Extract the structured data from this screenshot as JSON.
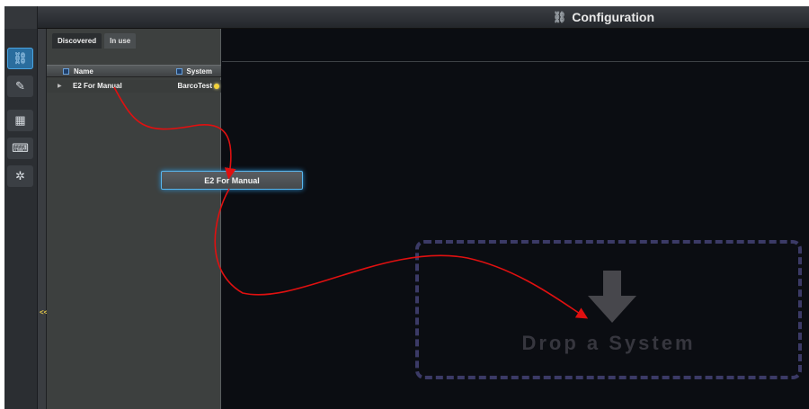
{
  "titlebar": {
    "title": "Configuration",
    "icon": "network-icon"
  },
  "rail": {
    "items": [
      {
        "icon": "network-icon",
        "glyph": "⛓",
        "active": true
      },
      {
        "icon": "edit-icon",
        "glyph": "✎",
        "active": false
      },
      {
        "icon": "grid-icon",
        "glyph": "▦",
        "active": false
      },
      {
        "icon": "keyboard-icon",
        "glyph": "⌨",
        "active": false
      },
      {
        "icon": "gear-icon",
        "glyph": "✲",
        "active": false
      }
    ]
  },
  "collapse": {
    "label": "<<"
  },
  "panel": {
    "tabs": [
      {
        "label": "Discovered"
      },
      {
        "label": "In use"
      }
    ],
    "columns": {
      "name": "Name",
      "system": "System"
    },
    "rows": [
      {
        "name": "E2 For Manual",
        "system": "BarcoTest",
        "status_color": "#f2d23a"
      }
    ]
  },
  "drag": {
    "label": "E2 For Manual"
  },
  "dropzone": {
    "label": "Drop a System"
  },
  "colors": {
    "accent": "#2a6d9e",
    "highlight": "#58b6ee",
    "annotation": "#e01010",
    "dropzone_border": "#3b3a66"
  }
}
